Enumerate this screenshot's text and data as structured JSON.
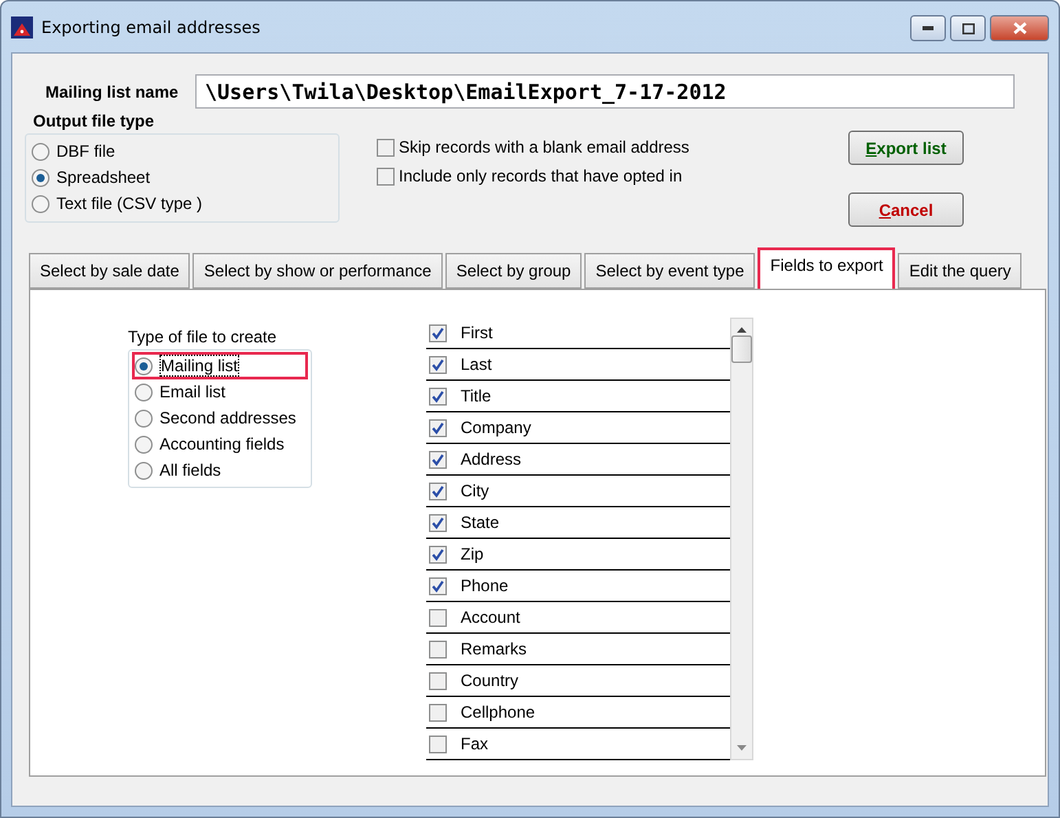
{
  "window": {
    "title": "Exporting email addresses"
  },
  "mailing_list_name": {
    "label": "Mailing list name",
    "value": "\\Users\\Twila\\Desktop\\EmailExport_7-17-2012"
  },
  "output_file_type": {
    "label": "Output file type",
    "options": [
      {
        "label": "DBF file",
        "selected": false
      },
      {
        "label": "Spreadsheet",
        "selected": true
      },
      {
        "label": "Text file (CSV type )",
        "selected": false
      }
    ]
  },
  "options": [
    {
      "label": "Skip records with a blank email address",
      "checked": false
    },
    {
      "label": "Include only records that have opted in",
      "checked": false
    }
  ],
  "buttons": [
    {
      "label": "Export list",
      "kind": "primary"
    },
    {
      "label": "Cancel",
      "kind": "cancel"
    }
  ],
  "tabs": [
    {
      "label": "Select by sale date",
      "selected": false,
      "highlighted": false
    },
    {
      "label": "Select by show or performance",
      "selected": false,
      "highlighted": false
    },
    {
      "label": "Select by group",
      "selected": false,
      "highlighted": false
    },
    {
      "label": "Select by event type",
      "selected": false,
      "highlighted": false
    },
    {
      "label": "Fields to export",
      "selected": true,
      "highlighted": true
    },
    {
      "label": "Edit the query",
      "selected": false,
      "highlighted": false
    }
  ],
  "file_type": {
    "label": "Type of file to create",
    "options": [
      {
        "label": "Mailing list",
        "selected": true,
        "highlighted": true
      },
      {
        "label": "Email list",
        "selected": false,
        "highlighted": false
      },
      {
        "label": "Second addresses",
        "selected": false,
        "highlighted": false
      },
      {
        "label": "Accounting fields",
        "selected": false,
        "highlighted": false
      },
      {
        "label": "All fields",
        "selected": false,
        "highlighted": false
      }
    ]
  },
  "fields": [
    {
      "label": "First",
      "checked": true
    },
    {
      "label": "Last",
      "checked": true
    },
    {
      "label": "Title",
      "checked": true
    },
    {
      "label": "Company",
      "checked": true
    },
    {
      "label": "Address",
      "checked": true
    },
    {
      "label": "City",
      "checked": true
    },
    {
      "label": "State",
      "checked": true
    },
    {
      "label": "Zip",
      "checked": true
    },
    {
      "label": "Phone",
      "checked": true
    },
    {
      "label": "Account",
      "checked": false
    },
    {
      "label": "Remarks",
      "checked": false
    },
    {
      "label": "Country",
      "checked": false
    },
    {
      "label": "Cellphone",
      "checked": false
    },
    {
      "label": "Fax",
      "checked": false
    }
  ]
}
